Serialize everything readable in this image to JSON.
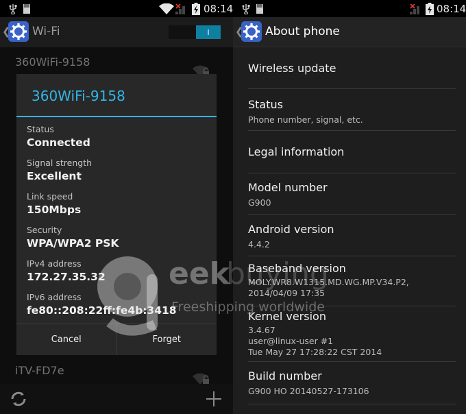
{
  "left_screen": {
    "status_bar": {
      "time": "08:14"
    },
    "action_bar": {
      "title": "Wi-Fi",
      "toggle_label": "I"
    },
    "networks": [
      {
        "name": "360WiFi-9158"
      },
      {
        "name": "iTV-FD7e"
      }
    ],
    "dialog": {
      "title": "360WiFi-9158",
      "fields": [
        {
          "label": "Status",
          "value": "Connected"
        },
        {
          "label": "Signal strength",
          "value": "Excellent"
        },
        {
          "label": "Link speed",
          "value": "150Mbps"
        },
        {
          "label": "Security",
          "value": "WPA/WPA2 PSK"
        },
        {
          "label": "IPv4 address",
          "value": "172.27.35.32"
        },
        {
          "label": "IPv6 address",
          "value": "fe80::208:22ff:fe4b:3418"
        }
      ],
      "cancel_label": "Cancel",
      "forget_label": "Forget"
    }
  },
  "right_screen": {
    "status_bar": {
      "time": "08:14"
    },
    "action_bar": {
      "title": "About phone"
    },
    "items": [
      {
        "title": "Wireless update",
        "summary": ""
      },
      {
        "title": "Status",
        "summary": "Phone number, signal, etc."
      },
      {
        "title": "Legal information",
        "summary": ""
      },
      {
        "title": "Model number",
        "summary": "G900"
      },
      {
        "title": "Android version",
        "summary": "4.4.2"
      },
      {
        "title": "Baseband version",
        "summary": "MOLY.WR8.W1315.MD.WG.MP.V34.P2, 2014/04/09 17:35"
      },
      {
        "title": "Kernel version",
        "summary": "3.4.67",
        "summary2": "user@linux-user #1",
        "summary3": "Tue May 27 17:28:22 CST 2014"
      },
      {
        "title": "Build number",
        "summary": "G900 HO 20140527-173106"
      }
    ]
  },
  "watermark": {
    "brand": "geekbuying",
    "tagline": "Freeshipping worldwide"
  },
  "colors": {
    "accent": "#33b5e5",
    "settings_icon": "#3a63c8"
  }
}
